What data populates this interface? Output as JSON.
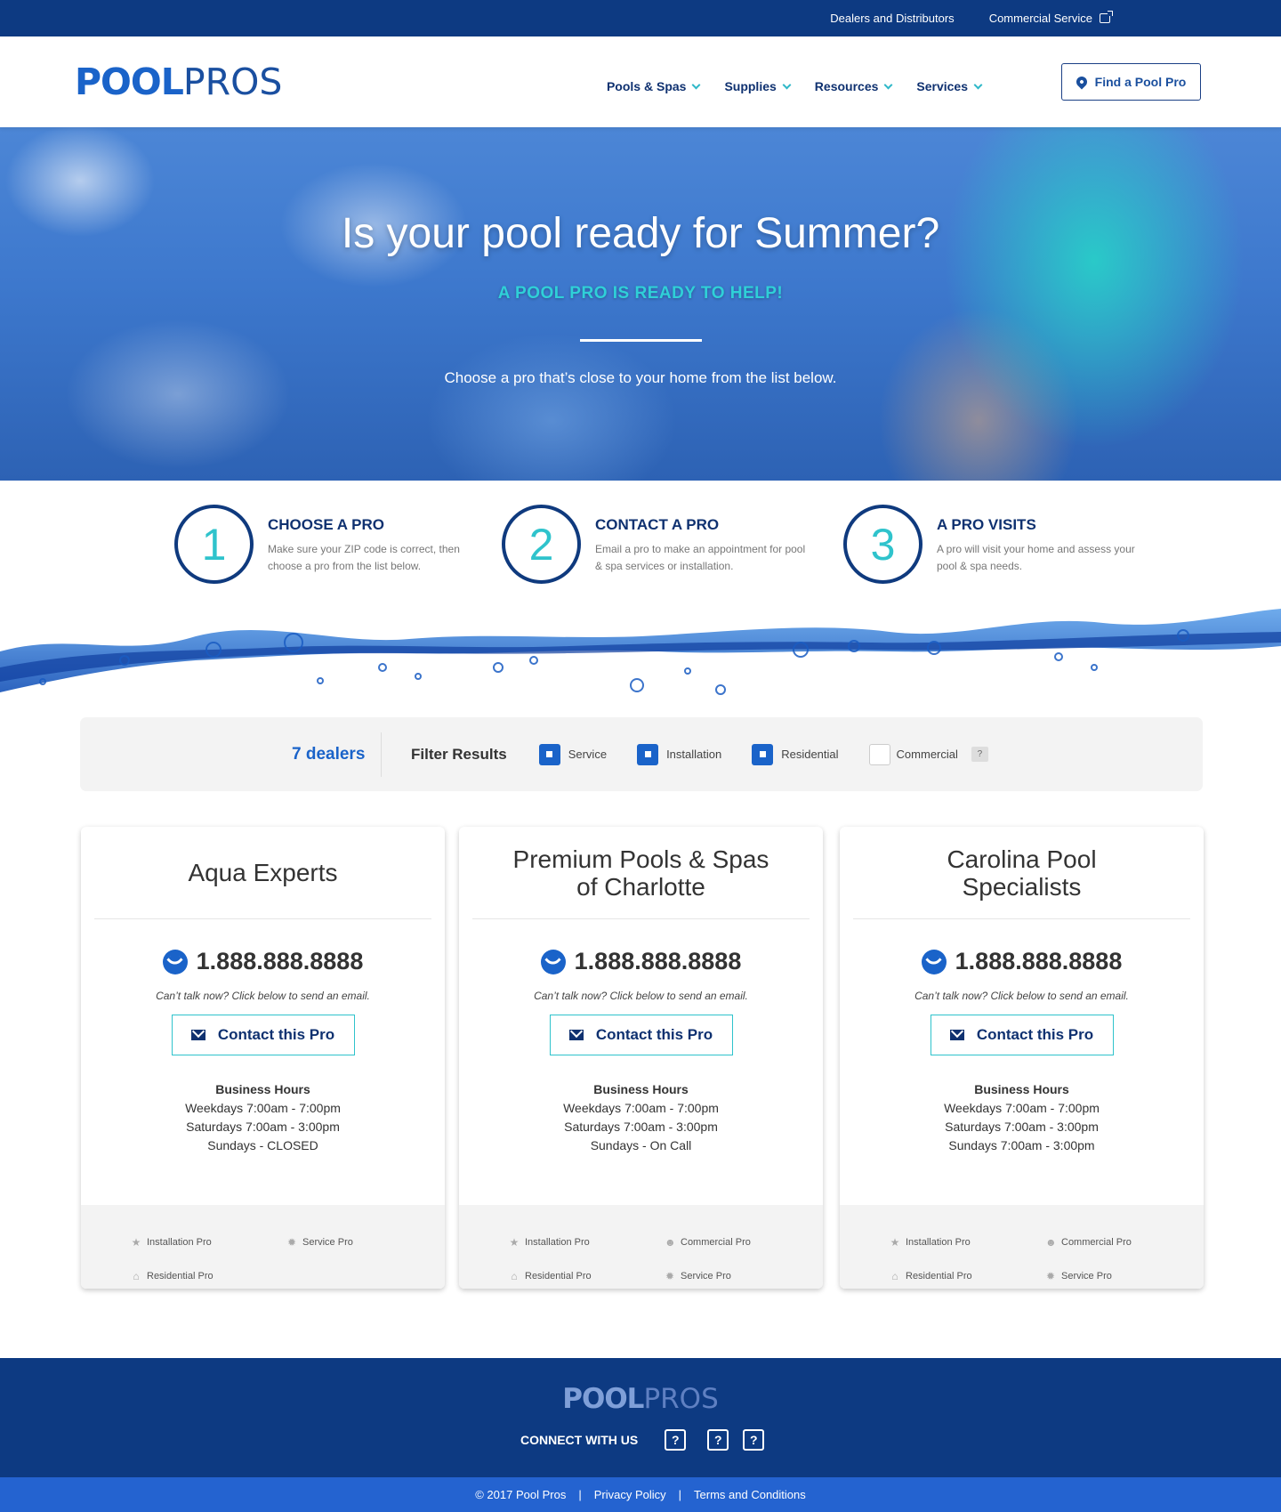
{
  "topbar": {
    "dealers": "Dealers and Distributors",
    "commercial": "Commercial Service"
  },
  "header": {
    "logo_bold": "POOL",
    "logo_light": "PROS",
    "nav": [
      {
        "label": "Pools & Spas"
      },
      {
        "label": "Supplies"
      },
      {
        "label": "Resources"
      },
      {
        "label": "Services"
      }
    ],
    "find_button": "Find a Pool Pro"
  },
  "hero": {
    "title": "Is your pool ready for Summer?",
    "subtitle": "A POOL PRO IS READY TO HELP!",
    "lead": "Choose a pro that’s close to your home from the list below."
  },
  "steps": [
    {
      "num": "1",
      "title": "CHOOSE A PRO",
      "desc": "Make sure your ZIP code is correct, then choose a pro from the list below."
    },
    {
      "num": "2",
      "title": "CONTACT A PRO",
      "desc": "Email a pro to make an appointment for pool & spa services or installation."
    },
    {
      "num": "3",
      "title": "A PRO VISITS",
      "desc": "A pro will visit your home and assess your pool & spa needs."
    }
  ],
  "filter": {
    "count": "7 dealers",
    "label": "Filter Results",
    "options": [
      {
        "label": "Service",
        "checked": true
      },
      {
        "label": "Installation",
        "checked": true
      },
      {
        "label": "Residential",
        "checked": true
      },
      {
        "label": "Commercial",
        "checked": false
      }
    ],
    "help": "?"
  },
  "dealers": [
    {
      "name": "Aqua Experts",
      "phone": "1.888.888.8888",
      "note": "Can’t talk now? Click below to send an email.",
      "contact": "Contact this Pro",
      "hours_title": "Business Hours",
      "hours": [
        "Weekdays 7:00am - 7:00pm",
        "Saturdays 7:00am - 3:00pm",
        "Sundays - CLOSED"
      ],
      "tags": [
        "Installation Pro",
        "Service Pro",
        "Residential Pro",
        ""
      ]
    },
    {
      "name": "Premium Pools & Spas of Charlotte",
      "phone": "1.888.888.8888",
      "note": "Can’t talk now? Click below to send an email.",
      "contact": "Contact this Pro",
      "hours_title": "Business Hours",
      "hours": [
        "Weekdays 7:00am - 7:00pm",
        "Saturdays 7:00am - 3:00pm",
        "Sundays - On Call"
      ],
      "tags": [
        "Installation Pro",
        "Commercial Pro",
        "Residential Pro",
        "Service Pro"
      ]
    },
    {
      "name": "Carolina Pool Specialists",
      "phone": "1.888.888.8888",
      "note": "Can’t talk now? Click below to send an email.",
      "contact": "Contact this Pro",
      "hours_title": "Business Hours",
      "hours": [
        "Weekdays 7:00am - 7:00pm",
        "Saturdays 7:00am - 3:00pm",
        "Sundays 7:00am - 3:00pm"
      ],
      "tags": [
        "Installation Pro",
        "Commercial Pro",
        "Residential Pro",
        "Service Pro"
      ]
    }
  ],
  "footer": {
    "logo_bold": "POOL",
    "logo_light": "PROS",
    "connect": "CONNECT WITH US",
    "social": [
      "?",
      "?",
      "?"
    ],
    "copyright": "© 2017 Pool Pros",
    "sep": "|",
    "privacy": "Privacy Policy",
    "terms": "Terms and Conditions"
  },
  "colors": {
    "navy": "#0d3a82",
    "brand_blue": "#1a63c9",
    "teal": "#2fc3cc",
    "subfooter": "#2463d0"
  }
}
